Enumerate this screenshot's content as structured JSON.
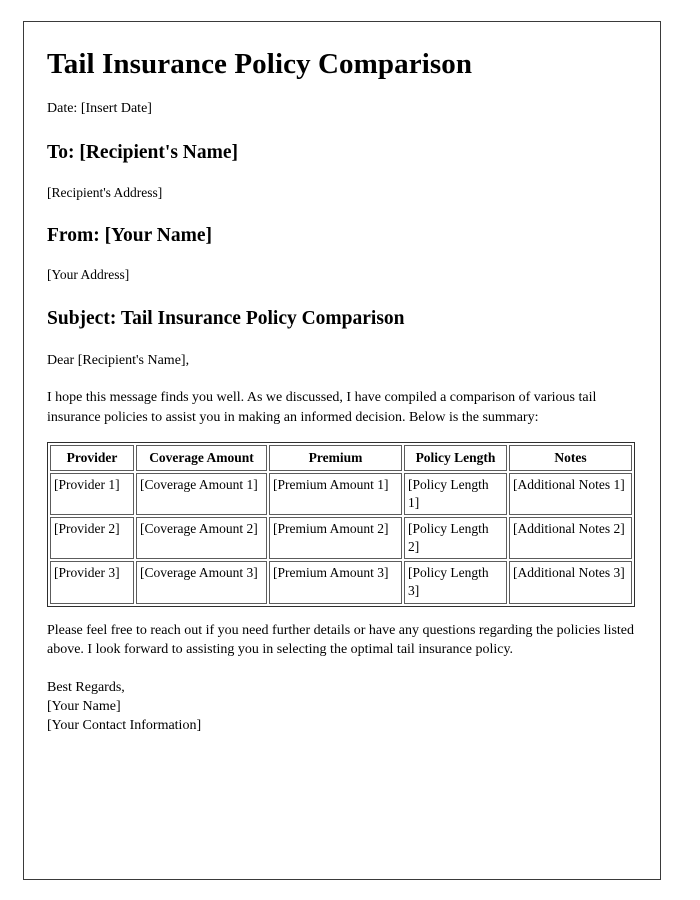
{
  "document": {
    "title": "Tail Insurance Policy Comparison",
    "date_line": "Date: [Insert Date]",
    "to_heading": "To: [Recipient's Name]",
    "recipient_address": "[Recipient's Address]",
    "from_heading": "From: [Your Name]",
    "sender_address": "[Your Address]",
    "subject_heading": "Subject: Tail Insurance Policy Comparison",
    "salutation": "Dear [Recipient's Name],",
    "intro_paragraph": "I hope this message finds you well. As we discussed, I have compiled a comparison of various tail insurance policies to assist you in making an informed decision. Below is the summary:",
    "closing_paragraph": "Please feel free to reach out if you need further details or have any questions regarding the policies listed above. I look forward to assisting you in selecting the optimal tail insurance policy.",
    "signoff": {
      "regards": "Best Regards,",
      "name": "[Your Name]",
      "contact": "[Your Contact Information]"
    }
  },
  "table": {
    "headers": [
      "Provider",
      "Coverage Amount",
      "Premium",
      "Policy Length",
      "Notes"
    ],
    "rows": [
      {
        "provider": "[Provider 1]",
        "coverage": "[Coverage Amount 1]",
        "premium": "[Premium Amount 1]",
        "length": "[Policy Length 1]",
        "notes": "[Additional Notes 1]"
      },
      {
        "provider": "[Provider 2]",
        "coverage": "[Coverage Amount 2]",
        "premium": "[Premium Amount 2]",
        "length": "[Policy Length 2]",
        "notes": "[Additional Notes 2]"
      },
      {
        "provider": "[Provider 3]",
        "coverage": "[Coverage Amount 3]",
        "premium": "[Premium Amount 3]",
        "length": "[Policy Length 3]",
        "notes": "[Additional Notes 3]"
      }
    ]
  },
  "colors": {
    "page_background": "#ffffff",
    "text": "#000000",
    "frame_border": "#3a3a3a",
    "table_border": "#2e2e2e",
    "cell_border": "#5c5c5c"
  }
}
